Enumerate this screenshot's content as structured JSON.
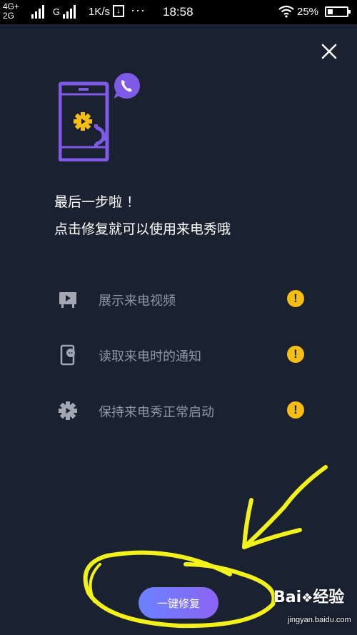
{
  "status_bar": {
    "network_top": "4G+",
    "network_bottom": "2G",
    "network_type": "G",
    "speed": "1K/s",
    "download_icon_glyph": "↓",
    "more_dots": "···",
    "time": "18:58",
    "battery_percent": "25%"
  },
  "header": {
    "close_icon": "close-icon"
  },
  "hero": {
    "icon": "phone-call-settings-illustration",
    "accent_color": "#7e5ae6",
    "gear_color": "#f6be12"
  },
  "title": {
    "line1": "最后一步啦 ！",
    "line2": "点击修复就可以使用来电秀哦"
  },
  "permissions": [
    {
      "icon": "video-board-icon",
      "label": "展示来电视频",
      "status_icon": "warning-icon",
      "status_glyph": "!"
    },
    {
      "icon": "phone-notification-icon",
      "label": "读取来电时的通知",
      "status_icon": "warning-icon",
      "status_glyph": "!"
    },
    {
      "icon": "gear-play-icon",
      "label": "保持来电秀正常启动",
      "status_icon": "warning-icon",
      "status_glyph": "!"
    }
  ],
  "fix_button": {
    "label": "一键修复"
  },
  "annotation": {
    "color": "#f2f21a",
    "shapes": [
      "arrow",
      "ellipse"
    ]
  },
  "watermark": {
    "brand": "Baiå¶ ç»éª",
    "brand_text": "Bai",
    "brand_cn": "经验",
    "url": "jingyan.baidu.com"
  }
}
